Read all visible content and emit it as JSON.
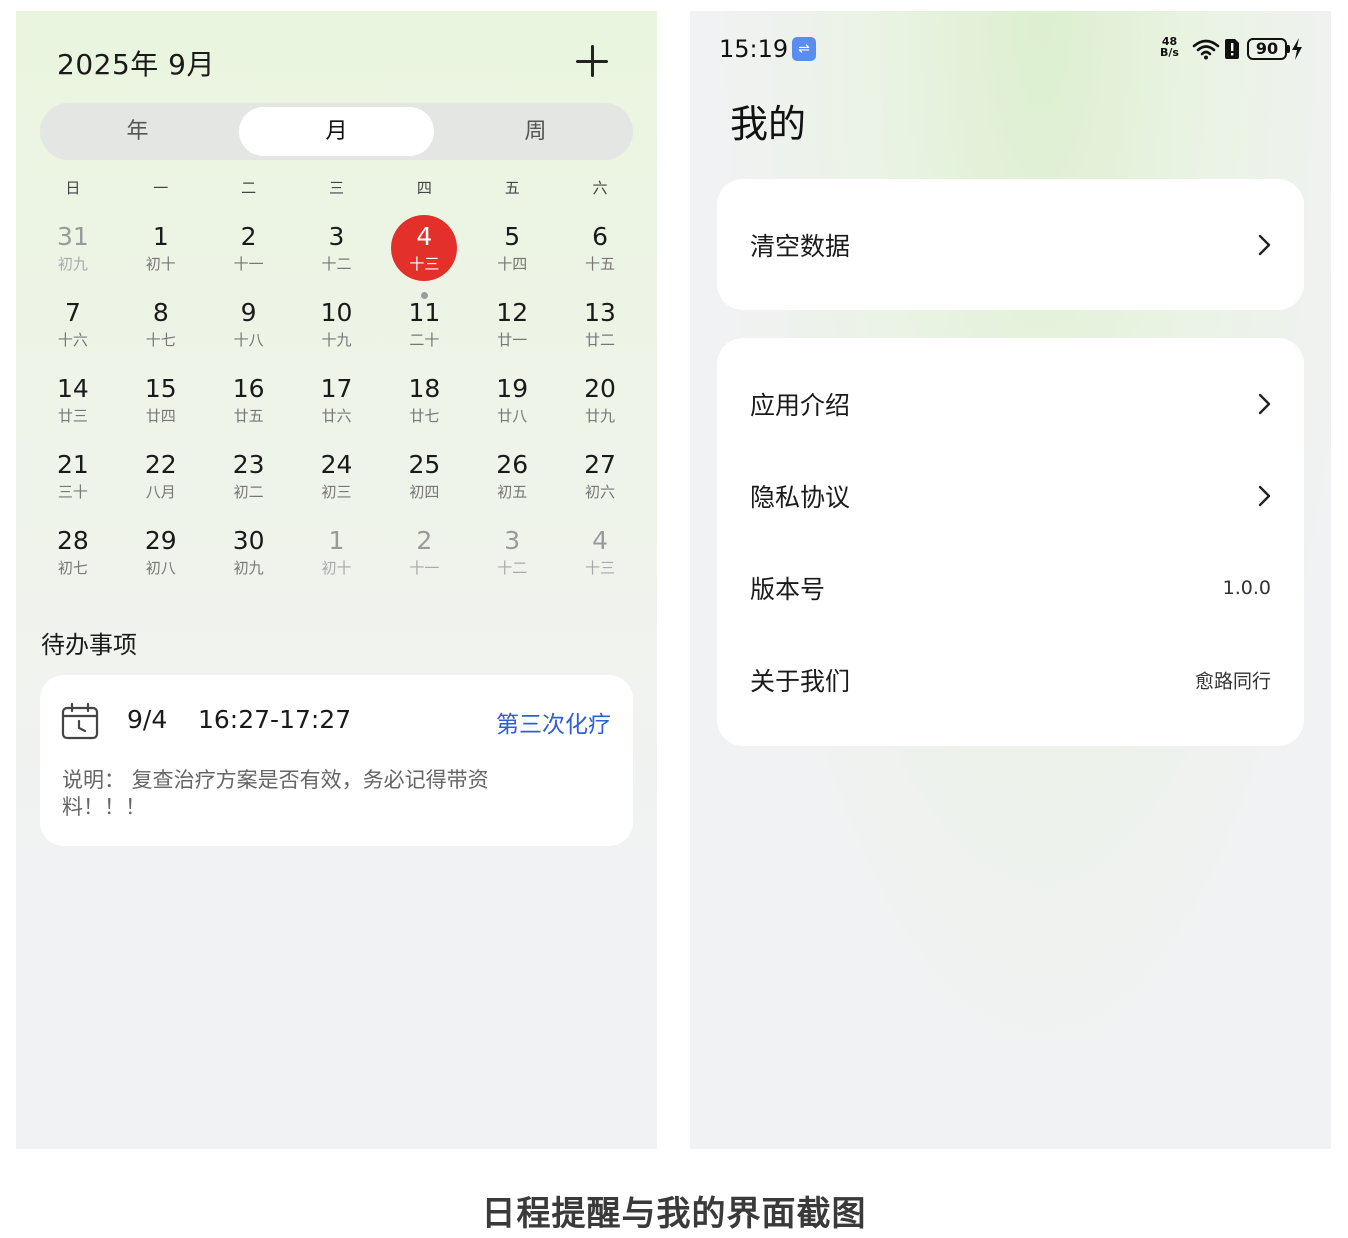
{
  "calendar": {
    "month_title": "2025年 9月",
    "view_tabs": [
      "年",
      "月",
      "周"
    ],
    "weekdays": [
      "日",
      "一",
      "二",
      "三",
      "四",
      "五",
      "六"
    ],
    "days": [
      {
        "num": "31",
        "lunar": "初九",
        "other": true
      },
      {
        "num": "1",
        "lunar": "初十"
      },
      {
        "num": "2",
        "lunar": "十一"
      },
      {
        "num": "3",
        "lunar": "十二"
      },
      {
        "num": "4",
        "lunar": "十三",
        "today": true,
        "has_event": true
      },
      {
        "num": "5",
        "lunar": "十四"
      },
      {
        "num": "6",
        "lunar": "十五"
      },
      {
        "num": "7",
        "lunar": "十六"
      },
      {
        "num": "8",
        "lunar": "十七"
      },
      {
        "num": "9",
        "lunar": "十八"
      },
      {
        "num": "10",
        "lunar": "十九"
      },
      {
        "num": "11",
        "lunar": "二十"
      },
      {
        "num": "12",
        "lunar": "廿一"
      },
      {
        "num": "13",
        "lunar": "廿二"
      },
      {
        "num": "14",
        "lunar": "廿三"
      },
      {
        "num": "15",
        "lunar": "廿四"
      },
      {
        "num": "16",
        "lunar": "廿五"
      },
      {
        "num": "17",
        "lunar": "廿六"
      },
      {
        "num": "18",
        "lunar": "廿七"
      },
      {
        "num": "19",
        "lunar": "廿八"
      },
      {
        "num": "20",
        "lunar": "廿九"
      },
      {
        "num": "21",
        "lunar": "三十"
      },
      {
        "num": "22",
        "lunar": "八月"
      },
      {
        "num": "23",
        "lunar": "初二"
      },
      {
        "num": "24",
        "lunar": "初三"
      },
      {
        "num": "25",
        "lunar": "初四"
      },
      {
        "num": "26",
        "lunar": "初五"
      },
      {
        "num": "27",
        "lunar": "初六"
      },
      {
        "num": "28",
        "lunar": "初七"
      },
      {
        "num": "29",
        "lunar": "初八"
      },
      {
        "num": "30",
        "lunar": "初九"
      },
      {
        "num": "1",
        "lunar": "初十",
        "other": true
      },
      {
        "num": "2",
        "lunar": "十一",
        "other": true
      },
      {
        "num": "3",
        "lunar": "十二",
        "other": true
      },
      {
        "num": "4",
        "lunar": "十三",
        "other": true
      }
    ],
    "today_color": "#e4302a"
  },
  "todo": {
    "heading": "待办事项",
    "date": "9/4",
    "time": "16:27-17:27",
    "title": "第三次化疗",
    "description": "说明： 复查治疗方案是否有效，务必记得带资料！！！",
    "icon": "calendar-clock-icon",
    "title_color": "#2f5fd4"
  },
  "status_bar": {
    "time": "15:19",
    "usb_icon": "usb-icon",
    "net_speed_value": "48",
    "net_speed_unit": "B/s",
    "battery": "90"
  },
  "mine": {
    "title": "我的",
    "rows_card1": [
      {
        "label": "清空数据",
        "chevron": true
      }
    ],
    "rows_card2": [
      {
        "label": "应用介绍",
        "chevron": true
      },
      {
        "label": "隐私协议",
        "chevron": true
      },
      {
        "label": "版本号",
        "value": "1.0.0"
      },
      {
        "label": "关于我们",
        "value": "愈路同行"
      }
    ]
  },
  "caption": "日程提醒与我的界面截图"
}
